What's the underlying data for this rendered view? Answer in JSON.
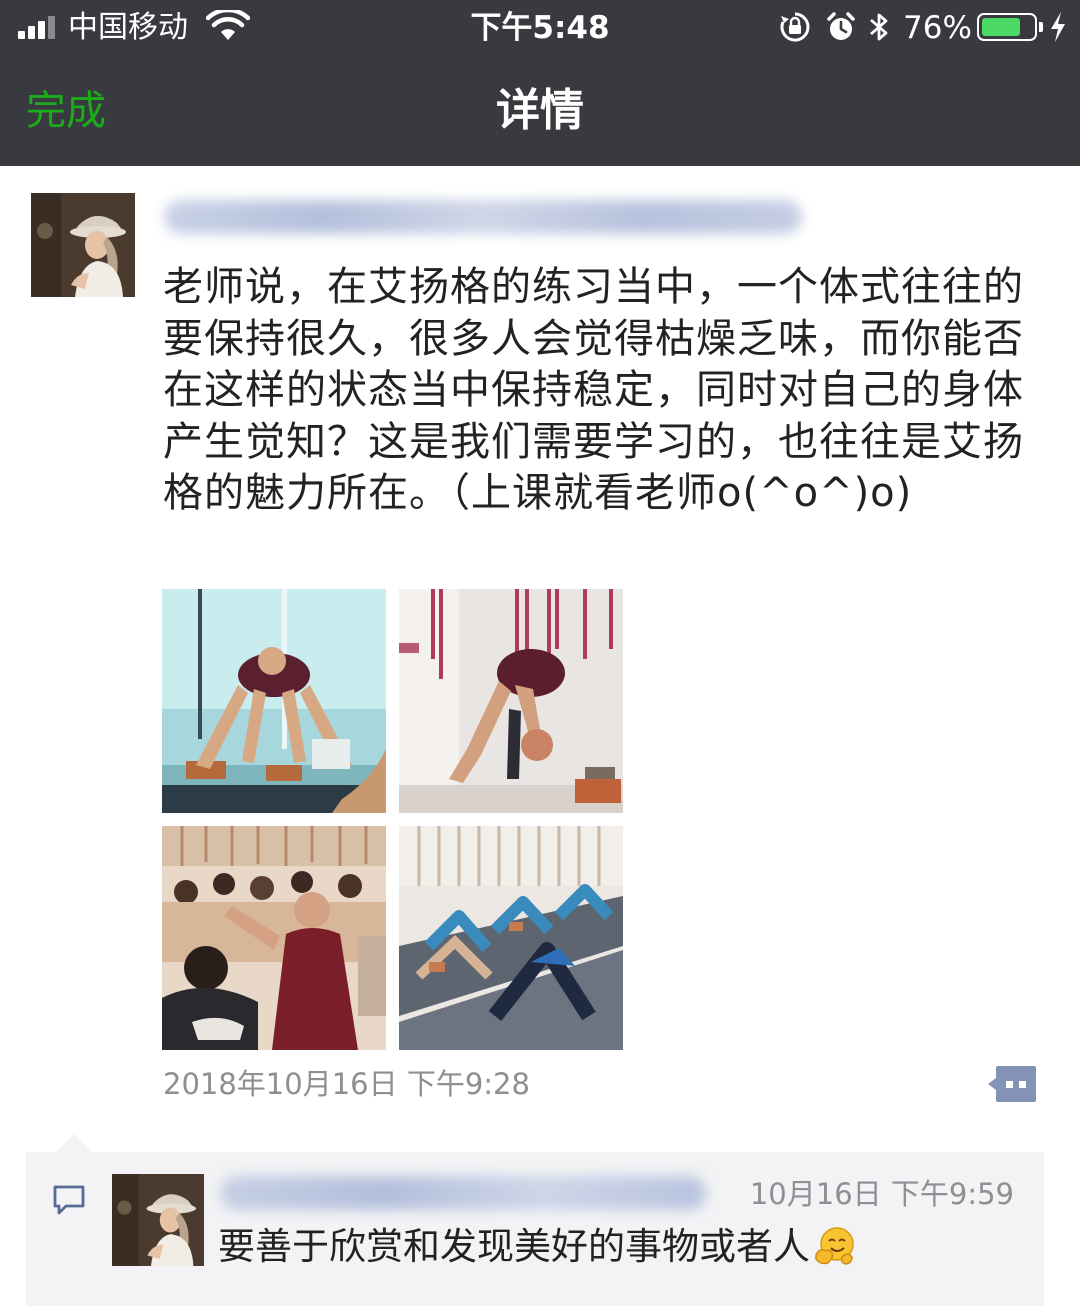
{
  "status_bar": {
    "carrier": "中国移动",
    "time": "下午5:48",
    "battery_percent": "76%",
    "battery_level": 0.76,
    "icons": [
      "signal-icon",
      "wifi-icon",
      "rotation-lock-icon",
      "alarm-icon",
      "bluetooth-icon",
      "battery-icon",
      "charging-icon"
    ]
  },
  "nav": {
    "done_label": "完成",
    "title": "详情"
  },
  "post": {
    "text": "老师说，在艾扬格的练习当中，一个体式往往的要保持很久，很多人会觉得枯燥乏味，而你能否在这样的状态当中保持稳定，同时对自己的身体产生觉知？这是我们需要学习的，也往往是艾扬格的魅力所在。（上课就看老师o(^o^)o)",
    "photos": [
      "photo-teacher-wide-stance",
      "photo-teacher-headstand-ropes",
      "photo-class-seated",
      "photo-class-downward-dog"
    ],
    "timestamp": "2018年10月16日 下午9:28"
  },
  "comment": {
    "time": "10月16日 下午9:59",
    "text": "要善于欣赏和发现美好的事物或者人",
    "emoji": "hugging-face-icon"
  },
  "colors": {
    "nav_bg": "#393a3f",
    "accent_green": "#1aad19",
    "link_blue": "#576b95",
    "comment_bg": "#f3f3f5",
    "meta_gray": "#8e8e93"
  }
}
